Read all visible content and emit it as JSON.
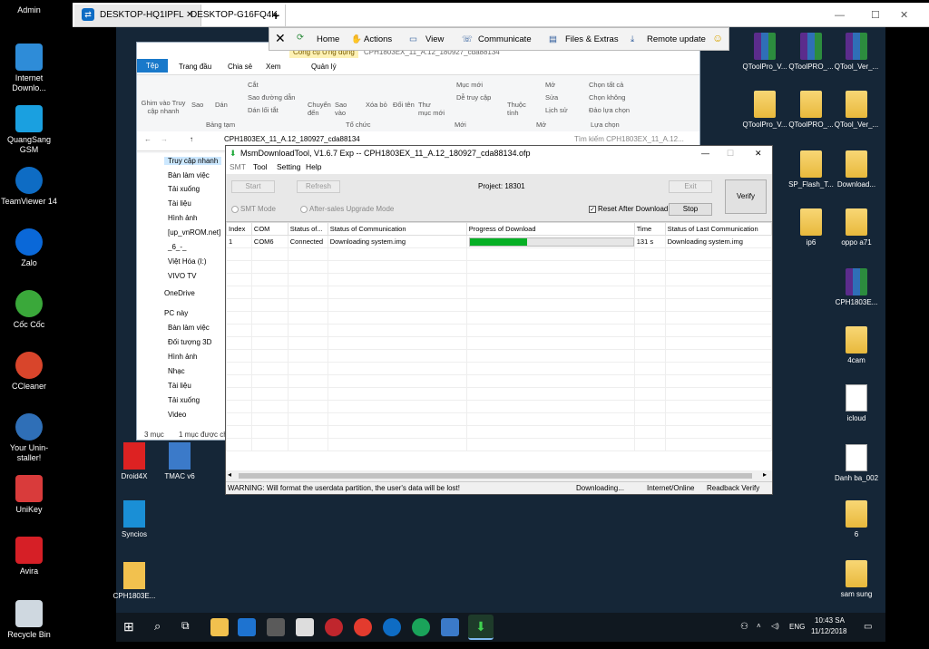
{
  "tv_tabs": [
    "DESKTOP-HQ1IPFL",
    "DESKTOP-G16FQ4K"
  ],
  "tv_toolbar": {
    "home": "Home",
    "actions": "Actions",
    "view": "View",
    "communicate": "Communicate",
    "files": "Files & Extras",
    "remote_update": "Remote update"
  },
  "left_icons": [
    {
      "label": "Admin",
      "icon": "user-folder-icon"
    },
    {
      "label": "Internet Downlo...",
      "icon": "idm-icon"
    },
    {
      "label": "QuangSang GSM",
      "icon": "laptop-icon"
    },
    {
      "label": "TeamViewer 14",
      "icon": "teamviewer-icon"
    },
    {
      "label": "Zalo",
      "icon": "zalo-icon"
    },
    {
      "label": "Cốc Cốc",
      "icon": "coccoc-icon"
    },
    {
      "label": "CCleaner",
      "icon": "ccleaner-icon"
    },
    {
      "label": "Your Unin-staller!",
      "icon": "uninstaller-icon"
    },
    {
      "label": "UniKey",
      "icon": "unikey-icon"
    },
    {
      "label": "Avira",
      "icon": "avira-icon"
    },
    {
      "label": "Recycle Bin",
      "icon": "recycle-bin-icon"
    }
  ],
  "remote_left_icons": [
    {
      "label": "Droid4X"
    },
    {
      "label": "TMAC v6"
    },
    {
      "label": "Syncios"
    },
    {
      "label": "CPH1803E..."
    }
  ],
  "remote_right_icons": [
    {
      "label": "QToolPro_V...",
      "type": "rar"
    },
    {
      "label": "QToolPRO_...",
      "type": "rar"
    },
    {
      "label": "QTool_Ver_...",
      "type": "rar"
    },
    {
      "label": "QToolPro_V...",
      "type": "folder"
    },
    {
      "label": "QToolPRO_...",
      "type": "folder"
    },
    {
      "label": "QTool_Ver_...",
      "type": "folder"
    },
    {
      "label": "SP_Flash_T...",
      "type": "folder"
    },
    {
      "label": "Download...",
      "type": "folder"
    },
    {
      "label": "ip6",
      "type": "folder"
    },
    {
      "label": "oppo a71",
      "type": "folder"
    },
    {
      "label": "CPH1803E...",
      "type": "rar"
    },
    {
      "label": "4cam",
      "type": "folder"
    },
    {
      "label": "icloud",
      "type": "doc"
    },
    {
      "label": "Danh ba_002",
      "type": "doc"
    },
    {
      "label": "6",
      "type": "folder"
    },
    {
      "label": "sam sung",
      "type": "folder"
    }
  ],
  "explorer": {
    "context_tab": "Công cụ Ứng dụng",
    "title": "CPH1803EX_11_A.12_180927_cda88134",
    "tabs": [
      "Tệp",
      "Trang đầu",
      "Chia sẻ",
      "Xem",
      "Quản lý"
    ],
    "ribbon": {
      "pin": "Ghim vào Truy cập nhanh",
      "copy": "Sao",
      "paste": "Dán",
      "cut": "Cắt",
      "copy_path": "Sao đường dẫn",
      "paste_shortcut": "Dán lối tắt",
      "clipboard": "Bảng tạm",
      "move_to": "Chuyển đến",
      "copy_to": "Sao vào",
      "delete": "Xóa bỏ",
      "rename": "Đổi tên",
      "organize": "Tổ chức",
      "new_folder": "Thư mục mới",
      "new_item": "Mục mới",
      "easy_access": "Dễ truy cập",
      "new": "Mới",
      "properties": "Thuộc tính",
      "open": "Mở",
      "edit": "Sửa",
      "history": "Lịch sử",
      "open_group": "Mở",
      "select_all": "Chọn tất cả",
      "select_none": "Chọn không",
      "invert": "Đảo lựa chọn",
      "select": "Lựa chọn"
    },
    "address": "CPH1803EX_11_A.12_180927_cda88134",
    "search_placeholder": "Tìm kiếm CPH1803EX_11_A.12...",
    "nav": [
      "Truy cập nhanh",
      "Bàn làm việc",
      "Tải xuống",
      "Tài liệu",
      "Hình ảnh",
      "[up_vnROM.net]",
      "_6_-_",
      "Việt Hóa (I:)",
      "VIVO TV",
      "OneDrive",
      "PC này",
      "Bàn làm việc",
      "Đối tượng 3D",
      "Hình ảnh",
      "Nhạc",
      "Tài liệu",
      "Tải xuống",
      "Video"
    ],
    "status": "3 mục",
    "status_sel": "1 mục được ch"
  },
  "msm": {
    "title": "MsmDownloadTool, V1.6.7 Exp -- CPH1803EX_11_A.12_180927_cda88134.ofp",
    "menu": [
      "SMT",
      "Tool",
      "Setting",
      "Help"
    ],
    "start": "Start",
    "refresh": "Refresh",
    "project": "Project: 18301",
    "exit": "Exit",
    "verify": "Verify",
    "smt_mode": "SMT Mode",
    "after_sales": "After-sales Upgrade Mode",
    "reset_after": "Reset After Download",
    "stop": "Stop",
    "columns": [
      "Index",
      "COM",
      "Status of...",
      "Status of Communication",
      "Progress of Download",
      "Time",
      "Status of Last Communication"
    ],
    "rows": [
      {
        "index": "1",
        "com": "COM6",
        "status": "Connected",
        "comm": "Downloading system.img",
        "progress": 35,
        "time": "131 s",
        "last": "Downloading system.img"
      }
    ],
    "status_warning": "WARNING: Will format the userdata partition, the user's data will be lost!",
    "status_state": "Downloading...",
    "status_mode": "Internet/Online",
    "status_verify": "Readback Verify"
  },
  "taskbar": {
    "lang": "ENG",
    "time": "10:43 SA",
    "date": "11/12/2018"
  }
}
